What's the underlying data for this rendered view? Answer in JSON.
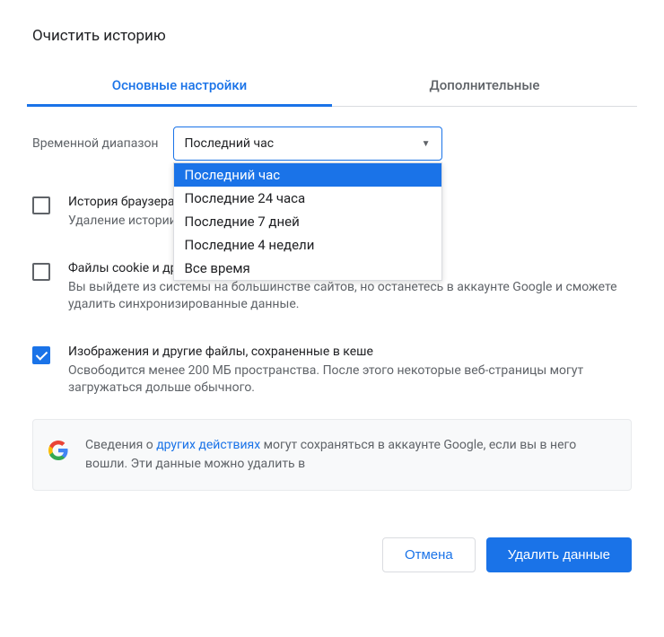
{
  "dialog": {
    "title": "Очистить историю"
  },
  "tabs": {
    "basic": "Основные настройки",
    "advanced": "Дополнительные"
  },
  "timeRange": {
    "label": "Временной диапазон",
    "selected": "Последний час",
    "options": [
      "Последний час",
      "Последние 24 часа",
      "Последние 7 дней",
      "Последние 4 недели",
      "Все время"
    ]
  },
  "items": {
    "history": {
      "title": "История браузера",
      "desc": "Удаление истории и автоподстановок на всех устройствах",
      "checked": false
    },
    "cookies": {
      "title": "Файлы cookie и другие данные сайтов",
      "desc": "Вы выйдете из системы на большинстве сайтов, но останетесь в аккаунте Google и сможете удалить синхронизированные данные.",
      "checked": false
    },
    "cache": {
      "title": "Изображения и другие файлы, сохраненные в кеше",
      "desc": "Освободится менее 200 МБ пространства. После этого некоторые веб-страницы могут загружаться дольше обычного.",
      "checked": true
    }
  },
  "info": {
    "prefix": "Сведения о ",
    "link": "других действиях",
    "suffix": " могут сохраняться в аккаунте Google, если вы в него вошли. Эти данные можно удалить в"
  },
  "actions": {
    "cancel": "Отмена",
    "confirm": "Удалить данные"
  }
}
